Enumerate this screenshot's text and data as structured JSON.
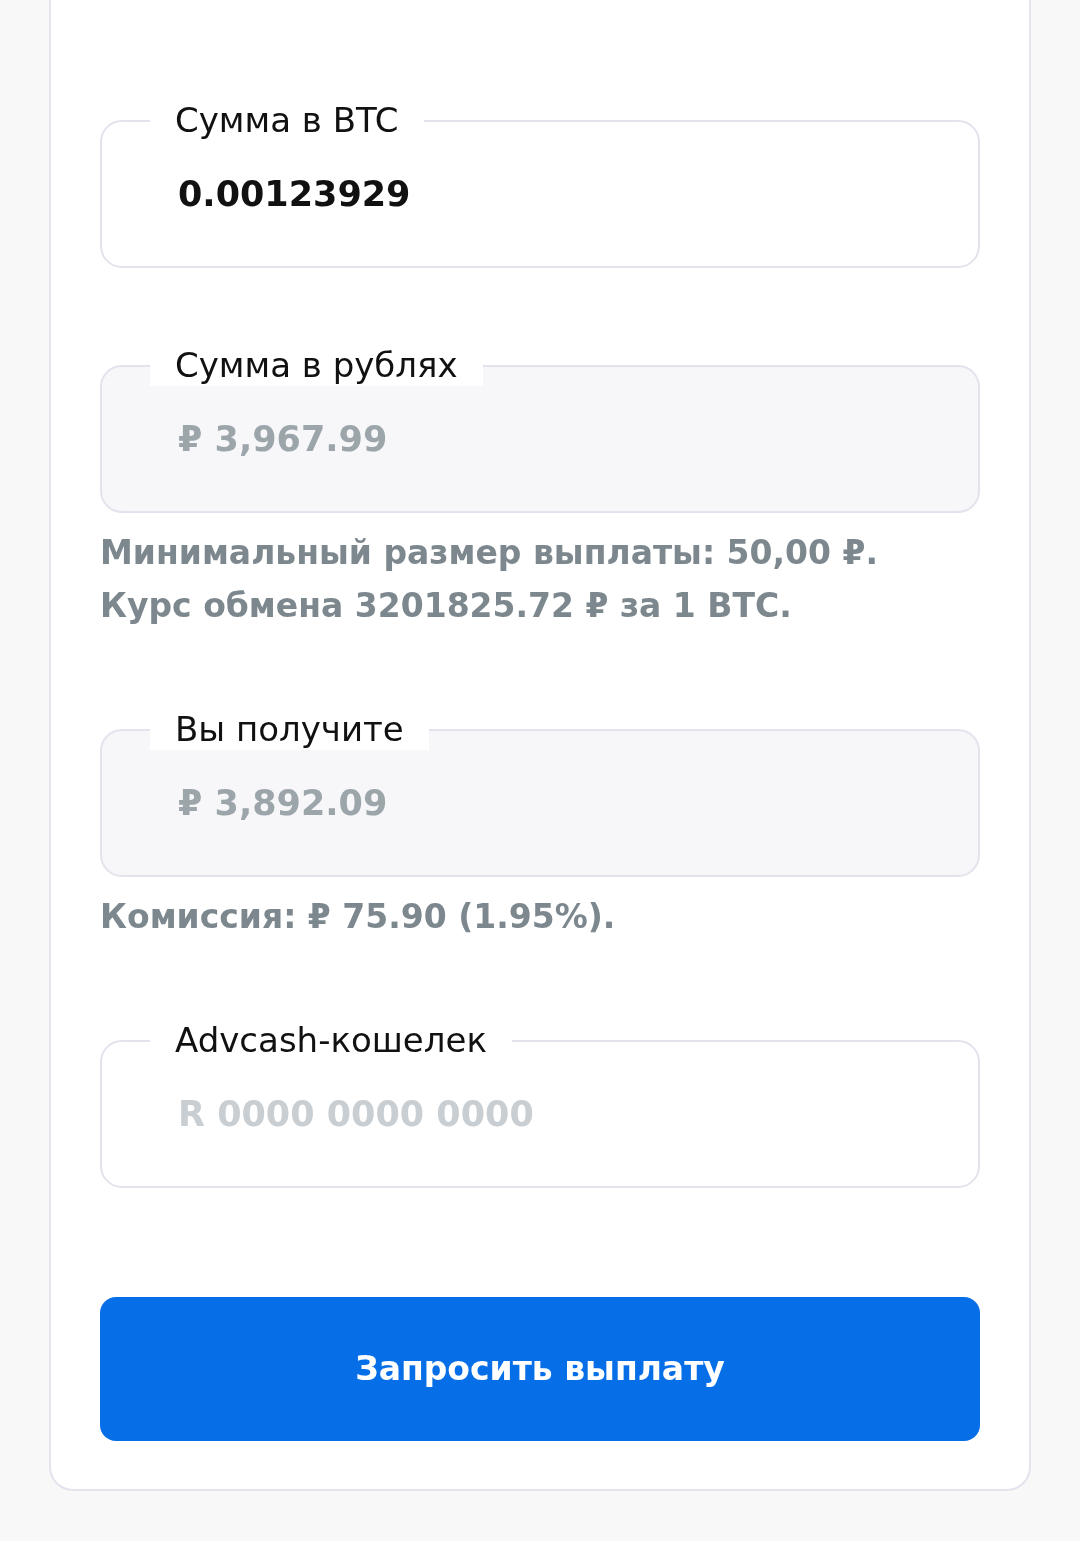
{
  "fields": [
    {
      "label": "Сумма в BTC",
      "value": "0.00123929",
      "disabled": false
    },
    {
      "label": "Сумма в рублях",
      "value": "₽ 3,967.99",
      "disabled": true,
      "hints": [
        "Минимальный размер выплаты: 50,00 ₽.",
        "Курс обмена 3201825.72 ₽ за 1 BTC."
      ]
    },
    {
      "label": "Вы получите",
      "value": "₽ 3,892.09",
      "disabled": true,
      "hints": [
        "Комиссия: ₽ 75.90 (1.95%)."
      ]
    },
    {
      "label": "Advcash-кошелек",
      "placeholder": "R 0000 0000 0000",
      "disabled": false
    }
  ],
  "submit_button": {
    "label": "Запросить выплату"
  }
}
